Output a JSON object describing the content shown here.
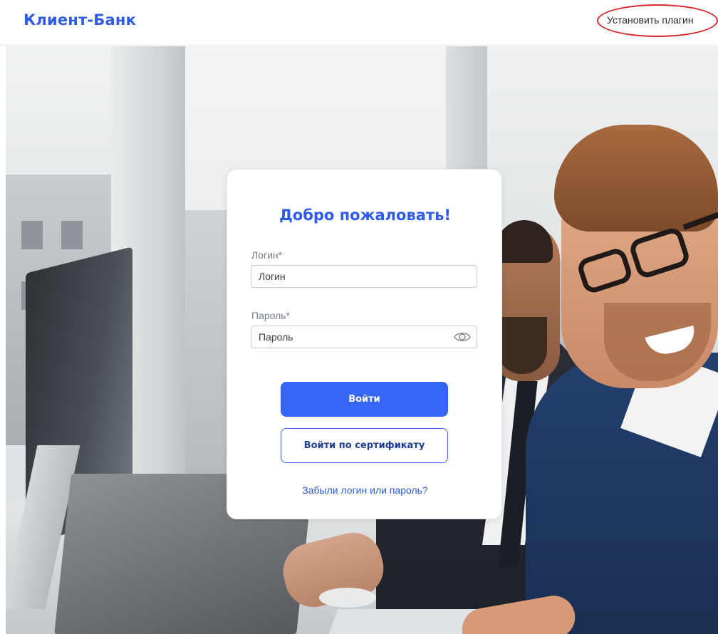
{
  "header": {
    "brand": "Клиент-Банк",
    "install_plugin_label": "Установить плагин"
  },
  "login": {
    "title": "Добро пожаловать!",
    "login_label": "Логин*",
    "login_placeholder": "Логин",
    "password_label": "Пароль*",
    "password_placeholder": "Пароль",
    "submit_label": "Войти",
    "certificate_label": "Войти по сертификату",
    "forgot_label": "Забыли логин или пароль?"
  },
  "icons": {
    "password_toggle": "eye-icon"
  },
  "colors": {
    "brand": "#2f5bea",
    "primary_button": "#3566f5",
    "highlight_ring": "#d6252b"
  }
}
